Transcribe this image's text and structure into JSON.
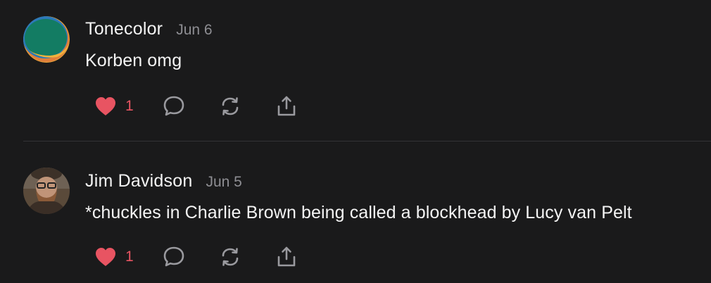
{
  "posts": [
    {
      "author": "Tonecolor",
      "date": "Jun 6",
      "text": "Korben omg",
      "like_count": "1",
      "avatar_icon": "tonecolor-logo-avatar"
    },
    {
      "author": "Jim Davidson",
      "date": "Jun 5",
      "text": "*chuckles in Charlie Brown being called a blockhead by Lucy van Pelt",
      "like_count": "1",
      "avatar_icon": "user-photo-avatar"
    }
  ],
  "colors": {
    "background": "#1a1a1b",
    "like_red": "#e85462",
    "icon_gray": "#9a9a9f",
    "date_gray": "#8e8e93"
  },
  "icons": [
    "heart-icon",
    "reply-bubble-icon",
    "repost-icon",
    "share-icon"
  ]
}
